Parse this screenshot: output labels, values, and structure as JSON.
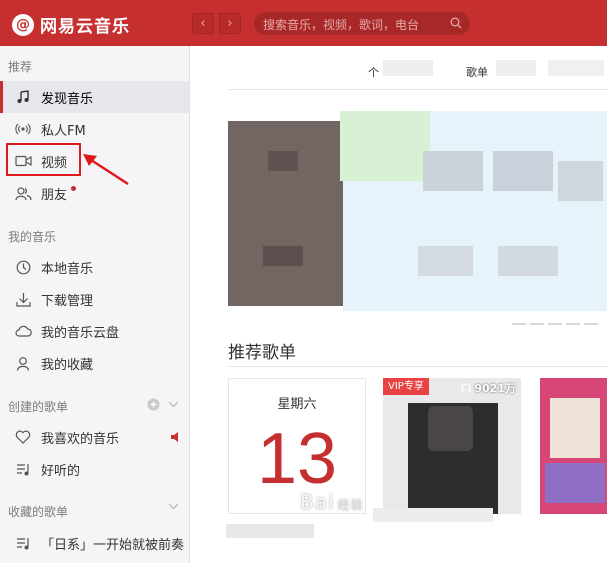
{
  "app": {
    "title": "网易云音乐",
    "logo_mark": "@",
    "brand_color": "#c62f2f"
  },
  "header": {
    "back_glyph": "‹",
    "forward_glyph": "›",
    "search_placeholder": "搜索音乐，视频，歌词，电台"
  },
  "sidebar": {
    "recommend_header": "推荐",
    "recommend_items": [
      {
        "label": "发现音乐",
        "icon": "music-note-icon",
        "active": true
      },
      {
        "label": "私人FM",
        "icon": "radio-icon"
      },
      {
        "label": "视频",
        "icon": "video-camera-icon",
        "highlighted": true
      },
      {
        "label": "朋友",
        "icon": "friends-icon",
        "has_dot": true
      }
    ],
    "my_music_header": "我的音乐",
    "my_music_items": [
      {
        "label": "本地音乐",
        "icon": "clock-icon"
      },
      {
        "label": "下载管理",
        "icon": "download-icon"
      },
      {
        "label": "我的音乐云盘",
        "icon": "cloud-icon"
      },
      {
        "label": "我的收藏",
        "icon": "person-icon"
      }
    ],
    "created_playlists_header": "创建的歌单",
    "created_playlists": [
      {
        "label": "我喜欢的音乐",
        "icon": "heart-icon",
        "playing": true
      },
      {
        "label": "好听的",
        "icon": "playlist-icon"
      }
    ],
    "collected_playlists_header": "收藏的歌单",
    "collected_playlists": [
      {
        "label": "「日系」一开始就被前奏",
        "icon": "playlist-icon"
      }
    ]
  },
  "main": {
    "tab_fragments": [
      "个",
      "歌单"
    ],
    "recommended_playlists_title": "推荐歌单",
    "calendar_card": {
      "weekday": "星期六",
      "day": "13"
    },
    "vip_card": {
      "badge": "VIP专享",
      "play_count": "9021万"
    }
  },
  "watermark": {
    "text": "Bai",
    "suffix": "经验"
  }
}
